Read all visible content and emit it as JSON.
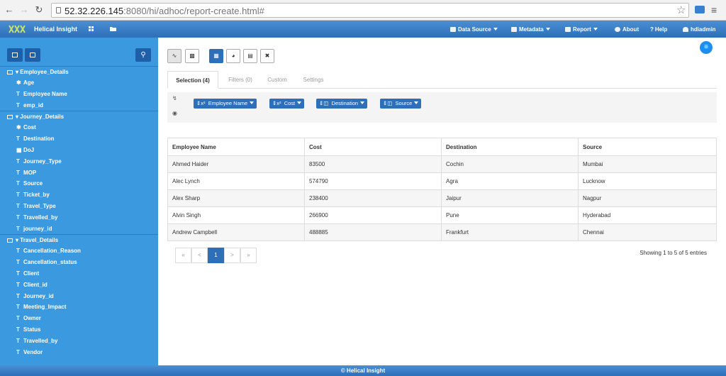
{
  "browser": {
    "url_host": "52.32.226.145",
    "url_rest": ":8080/hi/adhoc/report-create.html#"
  },
  "header": {
    "brand": "Helical Insight",
    "menus": [
      {
        "label": "Data Source",
        "has_caret": true
      },
      {
        "label": "Metadata",
        "has_caret": true
      },
      {
        "label": "Report",
        "has_caret": true
      },
      {
        "label": "About",
        "has_caret": false
      },
      {
        "label": "Help",
        "has_caret": false
      },
      {
        "label": "hdiadmin",
        "has_caret": false
      }
    ],
    "help_prefix": "?"
  },
  "sidebar": {
    "groups": [
      {
        "label": "Employee_Details",
        "items": [
          {
            "icon": "gear",
            "label": "Age"
          },
          {
            "icon": "text",
            "label": "Employee Name"
          },
          {
            "icon": "text",
            "label": "emp_id"
          }
        ]
      },
      {
        "label": "Journey_Details",
        "items": [
          {
            "icon": "gear",
            "label": "Cost"
          },
          {
            "icon": "text",
            "label": "Destination"
          },
          {
            "icon": "calendar",
            "label": "DoJ"
          },
          {
            "icon": "text",
            "label": "Journey_Type"
          },
          {
            "icon": "text",
            "label": "MOP"
          },
          {
            "icon": "text",
            "label": "Source"
          },
          {
            "icon": "text",
            "label": "Ticket_by"
          },
          {
            "icon": "text",
            "label": "Travel_Type"
          },
          {
            "icon": "text",
            "label": "Travelled_by"
          },
          {
            "icon": "text",
            "label": "journey_id"
          }
        ]
      },
      {
        "label": "Travel_Details",
        "items": [
          {
            "icon": "text",
            "label": "Cancellation_Reason"
          },
          {
            "icon": "text",
            "label": "Cancellation_status"
          },
          {
            "icon": "text",
            "label": "Client"
          },
          {
            "icon": "text",
            "label": "Client_id"
          },
          {
            "icon": "text",
            "label": "Journey_id"
          },
          {
            "icon": "text",
            "label": "Meeting_Impact"
          },
          {
            "icon": "text",
            "label": "Owner"
          },
          {
            "icon": "text",
            "label": "Status"
          },
          {
            "icon": "text",
            "label": "Travelled_by"
          },
          {
            "icon": "text",
            "label": "Vendor"
          }
        ]
      }
    ]
  },
  "tabs": [
    {
      "label": "Selection (4)",
      "active": true
    },
    {
      "label": "Filters (0)",
      "active": false
    },
    {
      "label": "Custom",
      "active": false
    },
    {
      "label": "Settings",
      "active": false
    }
  ],
  "selection_chips": [
    {
      "prefix": "⇕x²",
      "label": "Employee Name"
    },
    {
      "prefix": "⇕x²",
      "label": "Cost"
    },
    {
      "prefix": "⇕◫",
      "label": "Destination"
    },
    {
      "prefix": "⇕◫",
      "label": "Source"
    }
  ],
  "table": {
    "columns": [
      "Employee Name",
      "Cost",
      "Destination",
      "Source"
    ],
    "rows": [
      [
        "Ahmed Haider",
        "83500",
        "Cochin",
        "Mumbai"
      ],
      [
        "Alec Lynch",
        "574790",
        "Agra",
        "Lucknow"
      ],
      [
        "Alex Sharp",
        "238400",
        "Jaipur",
        "Nagpur"
      ],
      [
        "Alvin Singh",
        "266900",
        "Pune",
        "Hyderabad"
      ],
      [
        "Andrew Campbell",
        "488885",
        "Frankfurt",
        "Chennai"
      ]
    ]
  },
  "pagination": {
    "buttons": [
      "«",
      "<",
      "1",
      ">",
      "»"
    ],
    "active_page": "1",
    "info": "Showing 1 to 5 of 5 entries"
  },
  "footer": "© Helical Insight",
  "colors": {
    "header": "#2d6fb8",
    "sidebar": "#3b99e0",
    "accent": "#2d6fb8"
  }
}
